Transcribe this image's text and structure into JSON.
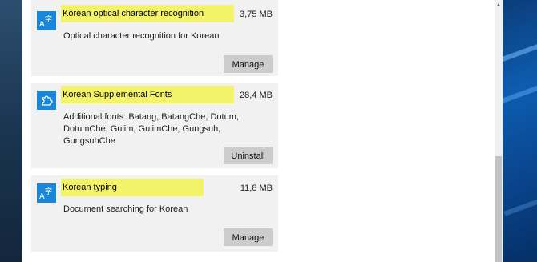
{
  "features": [
    {
      "icon": "font-language-icon",
      "icon_glyph_a": "A",
      "icon_glyph_b": "字",
      "title": "Korean optical character recognition",
      "size": "3,75 MB",
      "description": "Optical character recognition for Korean",
      "button": "Manage"
    },
    {
      "icon": "puzzle-piece-icon",
      "title": "Korean Supplemental Fonts",
      "size": "28,4 MB",
      "description": "Additional fonts: Batang, BatangChe, Dotum, DotumChe, Gulim, GulimChe, Gungsuh, GungsuhChe",
      "button": "Uninstall"
    },
    {
      "icon": "font-language-icon",
      "icon_glyph_a": "A",
      "icon_glyph_b": "字",
      "title": "Korean typing",
      "size": "11,8 MB",
      "description": "Document searching for Korean",
      "button": "Manage"
    }
  ],
  "colors": {
    "highlight": "#f3f36a",
    "icon_bg": "#1a86d9",
    "card_bg": "#f1f1f1",
    "button_bg": "#cccccc"
  },
  "scrollbar": {
    "up_arrow": "▲"
  }
}
